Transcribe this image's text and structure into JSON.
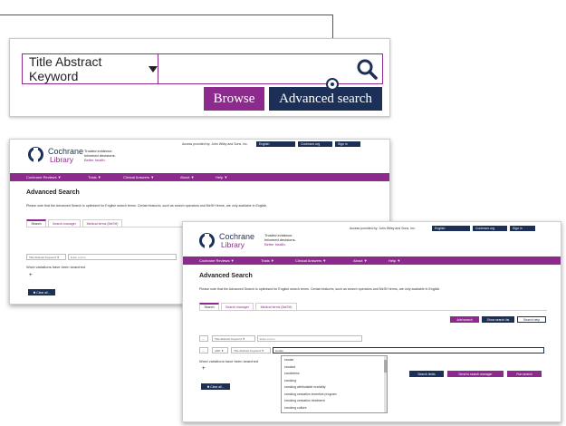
{
  "zoom": {
    "field_label": "Title Abstract Keyword",
    "search_placeholder": "",
    "browse_label": "Browse",
    "advanced_label": "Advanced search",
    "search_icon": "search-icon"
  },
  "header": {
    "brand_line1": "Cochrane",
    "brand_line2": "Library",
    "tagline1": "Trusted evidence.",
    "tagline2": "Informed decisions.",
    "tagline3": "Better health.",
    "access_text": "Access provided by: John Wiley and Sons, Inc.",
    "language": "English",
    "cochrane_link": "Cochrane.org",
    "sign_in": "Sign in"
  },
  "nav": {
    "items": [
      "Cochrane Reviews ▼",
      "Trials ▼",
      "Clinical Answers ▼",
      "About ▼",
      "Help ▼"
    ]
  },
  "page": {
    "title": "Advanced Search",
    "note": "Please note that the Advanced Search is optimised for English search terms. Certain features, such as search operators and MeSH terms, are only available in English.",
    "tabs": [
      "Search",
      "Search manager",
      "Medical terms (MeSH)"
    ],
    "field_select": "Title Abstract Keyword ▼",
    "input_placeholder": "Enter a term",
    "operator": "AND ▼",
    "row2_input_value": "smoke",
    "word_variations": "Word variations have been searched",
    "clear_all": "✖ Clear all...",
    "add_button": "+",
    "top_buttons": [
      "Add search",
      "Show search list",
      "Search help"
    ],
    "bottom_buttons": [
      "Search limits",
      "Send to search manager",
      "Run search"
    ]
  },
  "dropdown": {
    "items": [
      "smoke",
      "smoked",
      "smokeless",
      "smoking",
      "smoking attributable mortality",
      "smoking cessation incentive program",
      "smoking cessation treatment",
      "smoking culture"
    ]
  }
}
